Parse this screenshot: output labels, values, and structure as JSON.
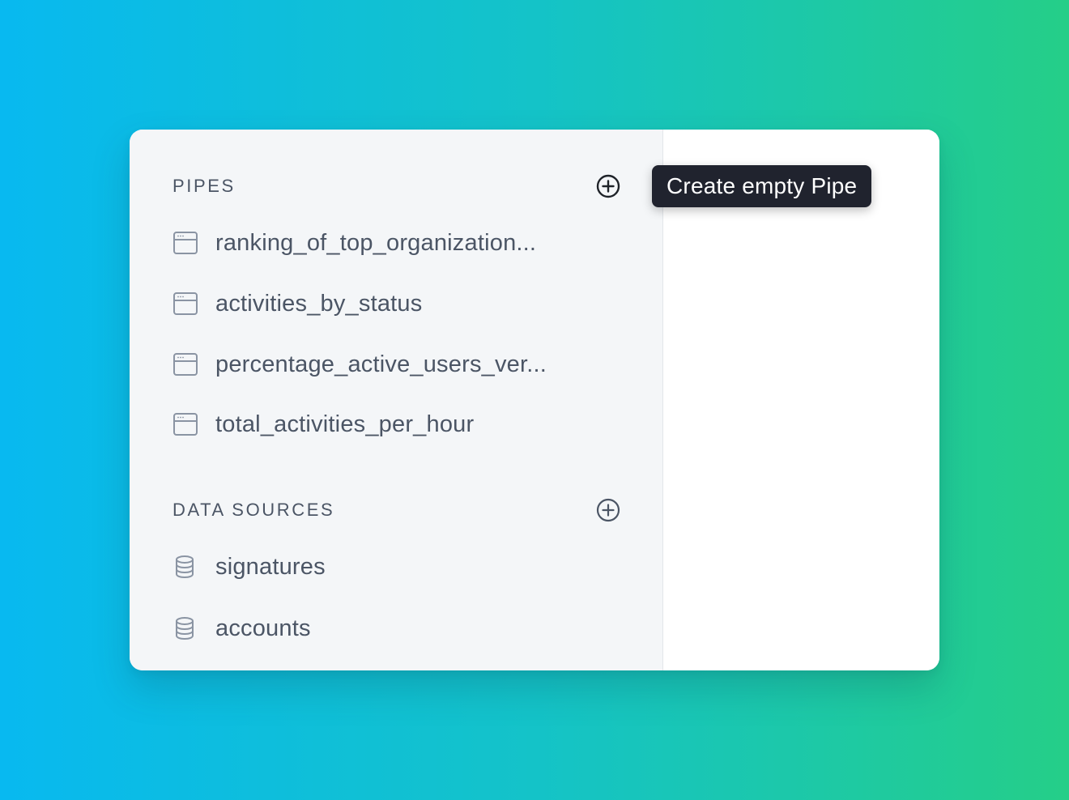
{
  "sidebar": {
    "pipes": {
      "title": "PIPES",
      "add_icon": "plus-circle-icon",
      "items": [
        {
          "label": "ranking_of_top_organization...",
          "icon": "pipe-icon"
        },
        {
          "label": "activities_by_status",
          "icon": "pipe-icon"
        },
        {
          "label": "percentage_active_users_ver...",
          "icon": "pipe-icon"
        },
        {
          "label": "total_activities_per_hour",
          "icon": "pipe-icon"
        }
      ]
    },
    "data_sources": {
      "title": "DATA SOURCES",
      "add_icon": "plus-circle-icon",
      "items": [
        {
          "label": "signatures",
          "icon": "database-icon"
        },
        {
          "label": "accounts",
          "icon": "database-icon"
        }
      ]
    }
  },
  "tooltip": {
    "text": "Create empty Pipe"
  },
  "colors": {
    "sidebar_bg": "#f4f6f8",
    "text": "#4b5565",
    "icon": "#8a94a3",
    "tooltip_bg": "#20232e",
    "background_start": "#08b9f0",
    "background_end": "#25ce88"
  }
}
